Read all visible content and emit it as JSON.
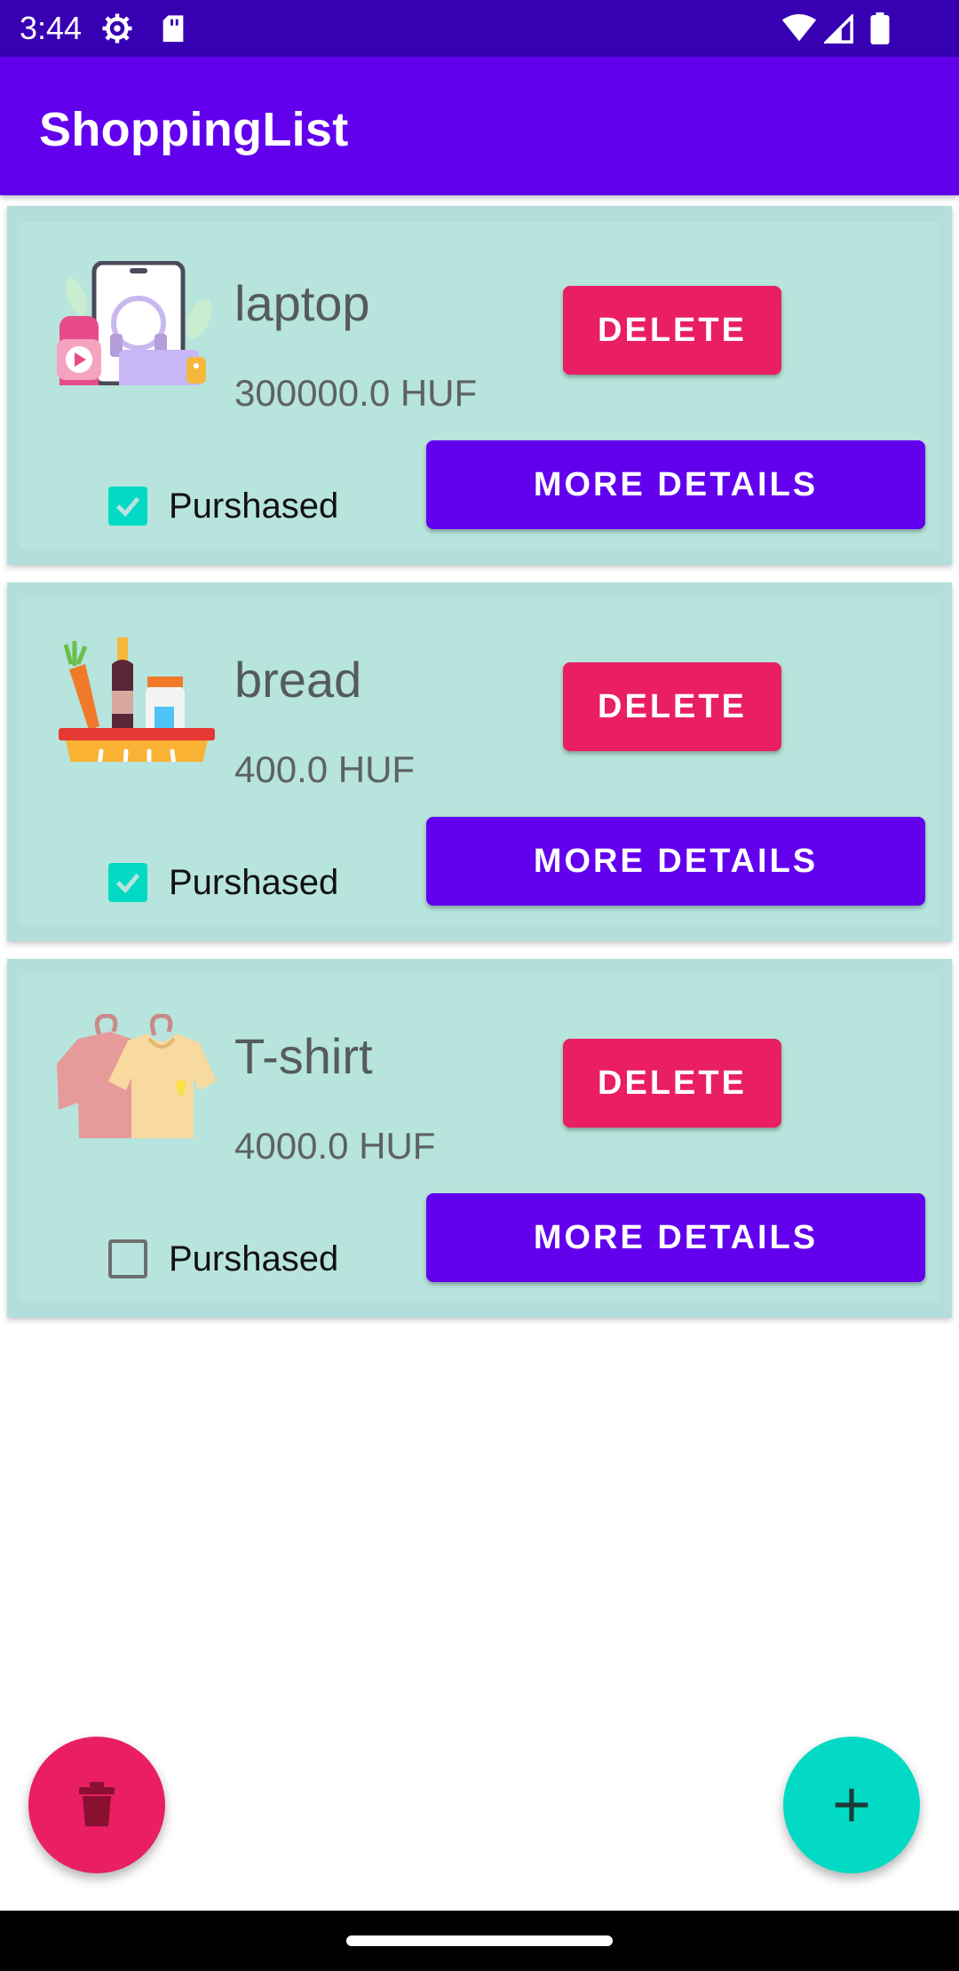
{
  "status_bar": {
    "time": "3:44",
    "icons": [
      "gear-icon",
      "sd-card-icon",
      "wifi-icon",
      "signal-icon",
      "battery-icon"
    ]
  },
  "app_bar": {
    "title": "ShoppingList"
  },
  "colors": {
    "primary": "#6200ee",
    "primary_dark": "#3700b3",
    "accent": "#03dac5",
    "delete": "#e91e63",
    "card_bg": "#b2dfdb"
  },
  "items": [
    {
      "name": "laptop",
      "price": "300000.0 HUF",
      "icon": "electronics-icon",
      "purchased": true,
      "checkbox_label": "Purshased",
      "delete_label": "DELETE",
      "details_label": "MORE DETAILS"
    },
    {
      "name": "bread",
      "price": "400.0 HUF",
      "icon": "grocery-basket-icon",
      "purchased": true,
      "checkbox_label": "Purshased",
      "delete_label": "DELETE",
      "details_label": "MORE DETAILS"
    },
    {
      "name": "T-shirt",
      "price": "4000.0 HUF",
      "icon": "clothes-icon",
      "purchased": false,
      "checkbox_label": "Purshased",
      "delete_label": "DELETE",
      "details_label": "MORE DETAILS"
    }
  ],
  "fabs": {
    "delete_all_icon": "trash-icon",
    "add_icon": "plus-icon"
  }
}
